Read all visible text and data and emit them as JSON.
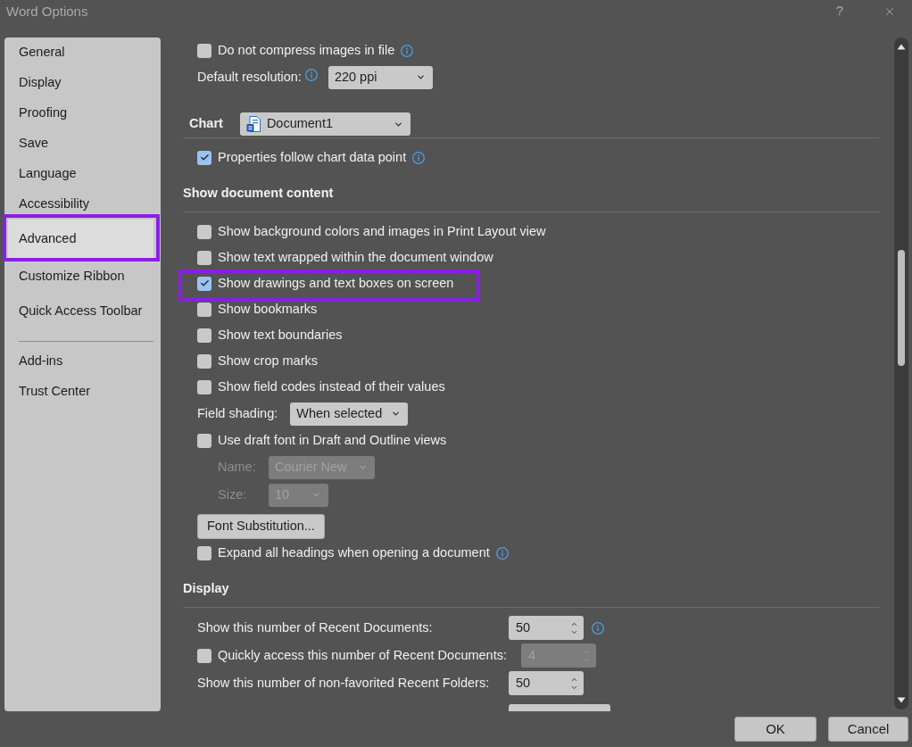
{
  "window": {
    "title": "Word Options",
    "help": "?"
  },
  "sidebar": {
    "groups": [
      {
        "items": [
          {
            "label": "General",
            "selected": false,
            "highlighted": false
          },
          {
            "label": "Display",
            "selected": false,
            "highlighted": false
          },
          {
            "label": "Proofing",
            "selected": false,
            "highlighted": false
          },
          {
            "label": "Save",
            "selected": false,
            "highlighted": false
          },
          {
            "label": "Language",
            "selected": false,
            "highlighted": false
          },
          {
            "label": "Accessibility",
            "selected": false,
            "highlighted": false
          },
          {
            "label": "Advanced",
            "selected": true,
            "highlighted": true
          },
          {
            "label": "Customize Ribbon",
            "selected": false,
            "highlighted": false
          },
          {
            "label": "Quick Access Toolbar",
            "selected": false,
            "highlighted": false
          }
        ]
      },
      {
        "items": [
          {
            "label": "Add-ins",
            "selected": false,
            "highlighted": false
          },
          {
            "label": "Trust Center",
            "selected": false,
            "highlighted": false
          }
        ]
      }
    ]
  },
  "content": {
    "rows": [
      {
        "kind": "checkbox",
        "label": "Do not compress images in file",
        "checked": false,
        "info": true,
        "highlighted": false
      },
      {
        "kind": "select",
        "label": "Default resolution:",
        "label_info": true,
        "control": {
          "kind": "dropdown",
          "value": "220 ppi",
          "disabled": false
        }
      },
      {
        "kind": "heading",
        "label": "Chart",
        "control": {
          "kind": "dropdown",
          "value": "Document1",
          "disabled": false,
          "icon": true
        }
      },
      {
        "kind": "checkbox",
        "label": "Properties follow chart data point",
        "checked": true,
        "info": true,
        "highlighted": false
      },
      {
        "kind": "heading",
        "label": "Show document content"
      },
      {
        "kind": "checkbox",
        "label": "Show background colors and images in Print Layout view",
        "checked": false,
        "info": false,
        "highlighted": false
      },
      {
        "kind": "checkbox",
        "label": "Show text wrapped within the document window",
        "checked": false,
        "info": false,
        "highlighted": false
      },
      {
        "kind": "checkbox",
        "label": "Show drawings and text boxes on screen",
        "checked": true,
        "info": false,
        "highlighted": true
      },
      {
        "kind": "checkbox",
        "label": "Show bookmarks",
        "checked": false,
        "info": false,
        "highlighted": false
      },
      {
        "kind": "checkbox",
        "label": "Show text boundaries",
        "checked": false,
        "info": false,
        "highlighted": false
      },
      {
        "kind": "checkbox",
        "label": "Show crop marks",
        "checked": false,
        "info": false,
        "highlighted": false
      },
      {
        "kind": "checkbox",
        "label": "Show field codes instead of their values",
        "checked": false,
        "info": false,
        "highlighted": false
      },
      {
        "kind": "select",
        "label": "Field shading:",
        "control": {
          "kind": "dropdown",
          "value": "When selected",
          "disabled": false
        }
      },
      {
        "kind": "checkbox",
        "label": "Use draft font in Draft and Outline views",
        "checked": false,
        "info": false,
        "highlighted": false,
        "children": [
          {
            "kind": "select",
            "label": "Name:",
            "control": {
              "kind": "dropdown",
              "value": "Courier New",
              "disabled": true
            }
          },
          {
            "kind": "select",
            "label": "Size:",
            "control": {
              "kind": "dropdown",
              "value": "10",
              "disabled": true
            }
          }
        ]
      },
      {
        "kind": "button",
        "label": "Font Substitution..."
      },
      {
        "kind": "checkbox",
        "label": "Expand all headings when opening a document",
        "checked": false,
        "info": true,
        "highlighted": false
      },
      {
        "kind": "heading",
        "label": "Display"
      },
      {
        "kind": "select",
        "label": "Show this number of Recent Documents:",
        "control": {
          "kind": "spinner",
          "value": "50",
          "disabled": false,
          "info": true
        }
      },
      {
        "kind": "checkbox",
        "label": "Quickly access this number of Recent Documents:",
        "checked": false,
        "info": false,
        "highlighted": false,
        "control": {
          "kind": "spinner",
          "value": "4",
          "disabled": true
        }
      },
      {
        "kind": "select",
        "label": "Show this number of non-favorited Recent Folders:",
        "control": {
          "kind": "spinner",
          "value": "50",
          "disabled": false
        }
      }
    ]
  },
  "footer": {
    "buttons": [
      "OK",
      "Cancel"
    ]
  }
}
